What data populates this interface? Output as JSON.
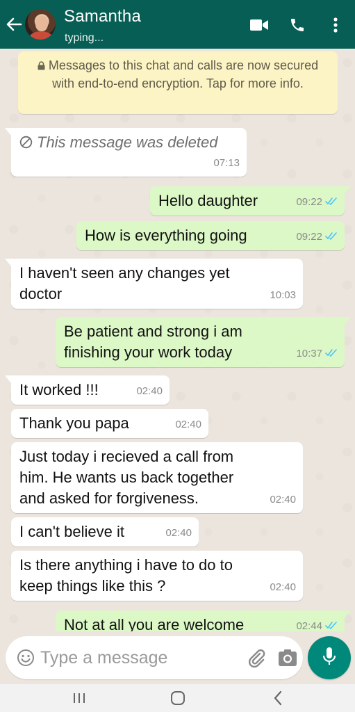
{
  "header": {
    "contact_name": "Samantha",
    "status": "typing...",
    "icons": [
      "back-arrow-icon",
      "avatar",
      "video-call-icon",
      "voice-call-icon",
      "more-options-icon"
    ],
    "color": "#075e54"
  },
  "encryption_notice": {
    "text": "Messages to this chat and calls are now secured with end-to-end encryption. Tap for more info.",
    "icon": "lock-icon"
  },
  "messages": [
    {
      "direction": "in",
      "deleted": true,
      "text": "This message was deleted",
      "time": "07:13"
    },
    {
      "direction": "out",
      "text": "Hello daughter",
      "time": "09:22",
      "ticks": "read"
    },
    {
      "direction": "out",
      "text": "How is everything going",
      "time": "09:22",
      "ticks": "read"
    },
    {
      "direction": "in",
      "lines": [
        "I haven't seen any changes yet",
        "doctor"
      ],
      "time": "10:03"
    },
    {
      "direction": "out",
      "lines": [
        "Be patient and strong i am",
        "finishing your work today"
      ],
      "time": "10:37",
      "ticks": "read"
    },
    {
      "direction": "in",
      "text": "It worked !!!",
      "time": "02:40"
    },
    {
      "direction": "in",
      "text": "Thank you papa",
      "time": "02:40"
    },
    {
      "direction": "in",
      "lines": [
        "Just today i recieved a call from",
        "him. He wants us back together",
        "and asked for forgiveness."
      ],
      "time": "02:40"
    },
    {
      "direction": "in",
      "text": "I can't believe it",
      "time": "02:40"
    },
    {
      "direction": "in",
      "lines": [
        "Is there anything i have to do to",
        "keep things like this ?"
      ],
      "time": "02:40"
    },
    {
      "direction": "out",
      "text": "Not at all you are welcome",
      "time": "02:44",
      "ticks": "read"
    }
  ],
  "composer": {
    "placeholder": "Type a message",
    "value": "",
    "icons": [
      "emoji-icon",
      "attach-icon",
      "camera-icon",
      "mic-icon"
    ],
    "mic_color": "#00897b"
  },
  "system_nav": {
    "icons": [
      "recent-apps-icon",
      "home-icon",
      "nav-back-icon"
    ]
  },
  "colors": {
    "incoming_bubble": "#ffffff",
    "outgoing_bubble": "#dcf8c6",
    "read_ticks": "#4fc3f7",
    "chat_background": "#ece5dd",
    "notice_background": "#fdf4c5"
  }
}
